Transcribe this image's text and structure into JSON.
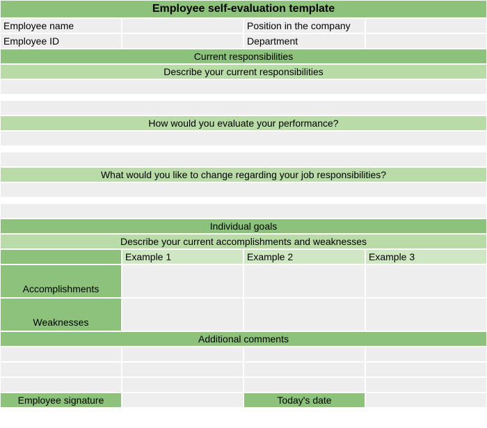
{
  "title": "Employee self-evaluation template",
  "info": {
    "employee_name_label": "Employee name",
    "employee_name_value": "",
    "position_label": "Position in the company",
    "position_value": "",
    "employee_id_label": "Employee ID",
    "employee_id_value": "",
    "department_label": "Department",
    "department_value": ""
  },
  "section1": {
    "header": "Current responsibilities",
    "q1": "Describe your current responsibilities",
    "q1_answer": "",
    "q2": "How would you evaluate your performance?",
    "q2_answer": "",
    "q3": "What would you like to change regarding your job responsibilities?",
    "q3_answer": ""
  },
  "section2": {
    "header": "Individual goals",
    "subheader": "Describe your current accomplishments and weaknesses",
    "examples": {
      "col1": "Example 1",
      "col2": "Example 2",
      "col3": "Example 3"
    },
    "rows": {
      "accomplishments_label": "Accomplishments",
      "accomplishments": {
        "c1": "",
        "c2": "",
        "c3": ""
      },
      "weaknesses_label": "Weaknesses",
      "weaknesses": {
        "c1": "",
        "c2": "",
        "c3": ""
      }
    }
  },
  "section3": {
    "header": "Additional comments",
    "rows": [
      {
        "c1": "",
        "c2": "",
        "c3": "",
        "c4": ""
      },
      {
        "c1": "",
        "c2": "",
        "c3": "",
        "c4": ""
      },
      {
        "c1": "",
        "c2": "",
        "c3": "",
        "c4": ""
      }
    ]
  },
  "signature": {
    "employee_signature_label": "Employee signature",
    "employee_signature_value": "",
    "todays_date_label": "Today's date",
    "todays_date_value": ""
  }
}
